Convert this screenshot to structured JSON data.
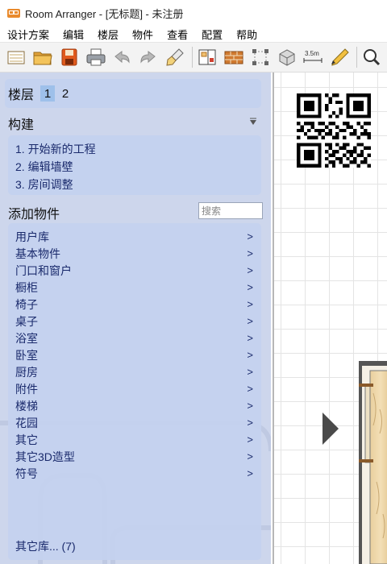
{
  "window": {
    "title": "Room Arranger - [无标题] - 未注册"
  },
  "menu": [
    "设计方案",
    "编辑",
    "楼层",
    "物件",
    "查看",
    "配置",
    "帮助"
  ],
  "toolbar": {
    "buttons": [
      {
        "name": "new-icon"
      },
      {
        "name": "open-folder-icon"
      },
      {
        "name": "save-icon"
      },
      {
        "name": "print-icon"
      },
      {
        "name": "undo-icon"
      },
      {
        "name": "redo-icon"
      },
      {
        "name": "brush-icon"
      },
      {
        "name": "floor-plan-icon"
      },
      {
        "name": "wall-icon"
      },
      {
        "name": "resize-icon"
      },
      {
        "name": "object-3d-icon"
      },
      {
        "name": "measure-icon",
        "label": "3.5m"
      },
      {
        "name": "pencil-ruler-icon"
      },
      {
        "name": "zoom-icon"
      }
    ]
  },
  "sidebar": {
    "floors": {
      "label": "楼层",
      "tabs": [
        "1",
        "2"
      ],
      "active": "1"
    },
    "build": {
      "header": "构建",
      "steps": [
        "1. 开始新的工程",
        "2. 编辑墙壁",
        "3. 房间调整"
      ]
    },
    "add_objects": {
      "header": "添加物件",
      "search_placeholder": "搜索",
      "categories": [
        {
          "label": "用户库",
          "arrow": ">"
        },
        {
          "label": "基本物件",
          "arrow": ">"
        },
        {
          "label": "门口和窗户",
          "arrow": ">"
        },
        {
          "label": "橱柜",
          "arrow": ">"
        },
        {
          "label": "椅子",
          "arrow": ">"
        },
        {
          "label": "桌子",
          "arrow": ">"
        },
        {
          "label": "浴室",
          "arrow": ">"
        },
        {
          "label": "卧室",
          "arrow": ">"
        },
        {
          "label": "厨房",
          "arrow": ">"
        },
        {
          "label": "附件",
          "arrow": ">"
        },
        {
          "label": "楼梯",
          "arrow": ">"
        },
        {
          "label": "花园",
          "arrow": ">"
        },
        {
          "label": "其它",
          "arrow": ">"
        },
        {
          "label": "其它3D造型",
          "arrow": ">"
        },
        {
          "label": "符号",
          "arrow": ">"
        }
      ],
      "more_libraries": "其它库... (7)"
    }
  },
  "colors": {
    "sidebar_bg": "#cdd6ec",
    "panel_bg": "#c4d2ef",
    "active_floor": "#9ec0ea",
    "link_text": "#1a2a6c"
  }
}
